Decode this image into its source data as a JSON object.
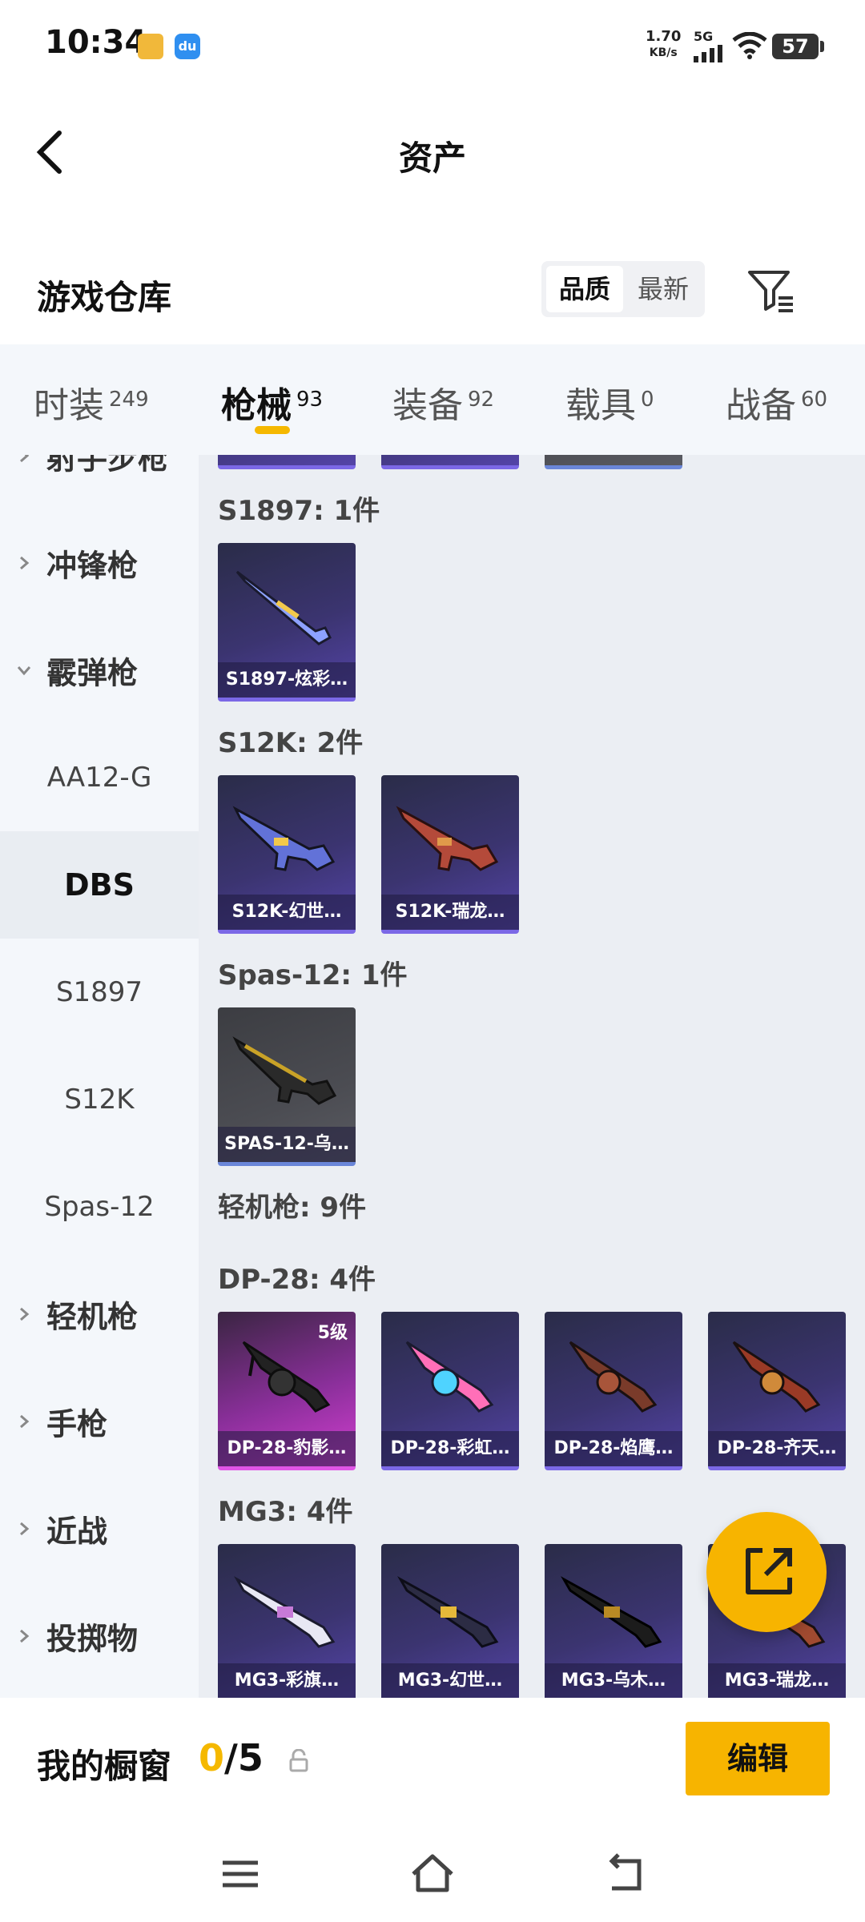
{
  "status_bar": {
    "time": "10:34",
    "speed_value": "1.70",
    "speed_unit": "KB/s",
    "network": "5G",
    "battery": "57",
    "app_icon_2": "du"
  },
  "header": {
    "title": "资产",
    "back_icon": "chevron-left-icon"
  },
  "section": {
    "title": "游戏仓库",
    "sort_options": [
      "品质",
      "最新"
    ],
    "active_sort": "品质",
    "filter_icon": "filter-icon"
  },
  "tabs": [
    {
      "label": "时装",
      "count": "249"
    },
    {
      "label": "枪械",
      "count": "93",
      "active": true
    },
    {
      "label": "装备",
      "count": "92"
    },
    {
      "label": "载具",
      "count": "0"
    },
    {
      "label": "战备",
      "count": "60"
    }
  ],
  "sidebar": {
    "items": [
      {
        "label": "射手步枪",
        "type": "category"
      },
      {
        "label": "冲锋枪",
        "type": "category"
      },
      {
        "label": "霰弹枪",
        "type": "category",
        "expanded": true
      },
      {
        "label": "AA12-G",
        "type": "sub"
      },
      {
        "label": "DBS",
        "type": "sub",
        "selected": true
      },
      {
        "label": "S1897",
        "type": "sub"
      },
      {
        "label": "S12K",
        "type": "sub"
      },
      {
        "label": "Spas-12",
        "type": "sub"
      },
      {
        "label": "轻机枪",
        "type": "category"
      },
      {
        "label": "手枪",
        "type": "category"
      },
      {
        "label": "近战",
        "type": "category"
      },
      {
        "label": "投掷物",
        "type": "category"
      }
    ]
  },
  "content": {
    "groups": [
      {
        "title": "S1897: 1件",
        "items": [
          {
            "name": "S1897-炫彩…",
            "style": "purple"
          }
        ]
      },
      {
        "title": "S12K: 2件",
        "items": [
          {
            "name": "S12K-幻世…",
            "style": "purple"
          },
          {
            "name": "S12K-瑞龙…",
            "style": "purple"
          }
        ]
      },
      {
        "title": "Spas-12: 1件",
        "items": [
          {
            "name": "SPAS-12-乌…",
            "style": "gray"
          }
        ]
      },
      {
        "title": "轻机枪: 9件",
        "items": []
      },
      {
        "title": "DP-28: 4件",
        "items": [
          {
            "name": "DP-28-豹影…",
            "style": "pink",
            "level": "5级"
          },
          {
            "name": "DP-28-彩虹…",
            "style": "purple"
          },
          {
            "name": "DP-28-焰鹰…",
            "style": "purple"
          },
          {
            "name": "DP-28-齐天…",
            "style": "purple"
          }
        ]
      },
      {
        "title": "MG3: 4件",
        "items": [
          {
            "name": "MG3-彩旗…",
            "style": "purple"
          },
          {
            "name": "MG3-幻世…",
            "style": "purple"
          },
          {
            "name": "MG3-乌木…",
            "style": "purple"
          },
          {
            "name": "MG3-瑞龙…",
            "style": "purple"
          }
        ]
      }
    ]
  },
  "bottom": {
    "showcase_label": "我的橱窗",
    "showcase_current": "0",
    "showcase_total": "/5",
    "edit_label": "编辑"
  },
  "fab": {
    "icon": "share-export-icon"
  },
  "nav": {
    "icons": [
      "menu-icon",
      "home-icon",
      "back-icon"
    ]
  },
  "colors": {
    "accent": "#f7b400",
    "purple_card": "#3b3470",
    "pink_card": "#d23fd0",
    "sidebar_bg": "#f4f7fb",
    "content_bg": "#ebeef3"
  }
}
